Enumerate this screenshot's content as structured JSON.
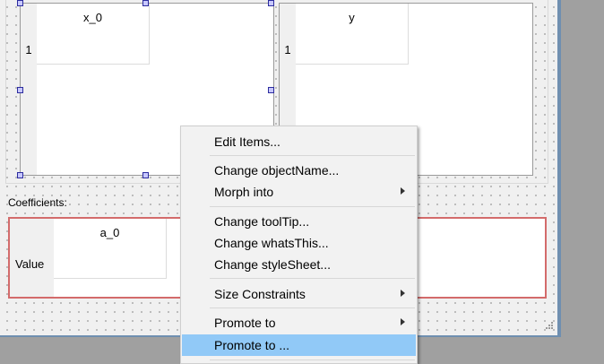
{
  "tables": {
    "x0": {
      "column_header": "x_0",
      "row_header": "1"
    },
    "y": {
      "column_header": "y",
      "row_header": "1"
    }
  },
  "coefficients": {
    "label": "Coefficients:",
    "column_header": "a_0",
    "row_header": "Value"
  },
  "context_menu": {
    "edit_items": "Edit Items...",
    "change_object_name": "Change objectName...",
    "morph_into": "Morph into",
    "change_tooltip": "Change toolTip...",
    "change_whatsthis": "Change whatsThis...",
    "change_stylesheet": "Change styleSheet...",
    "size_constraints": "Size Constraints",
    "promote_to_submenu": "Promote to",
    "promote_to_dialog": "Promote to ...",
    "highlighted_item": "Promote to ..."
  },
  "colors": {
    "selection_handle": "#2c2c9e",
    "menu_highlight": "#91c9f7",
    "coefficient_border": "#d36b6b"
  }
}
